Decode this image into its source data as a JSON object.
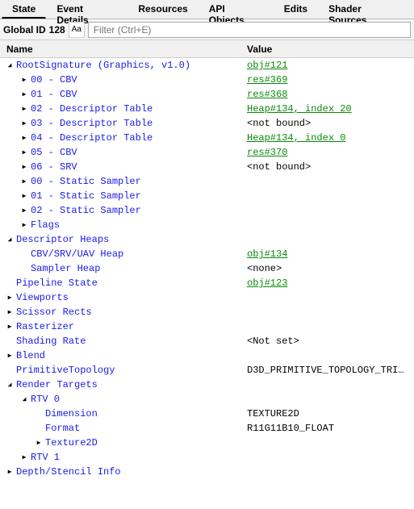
{
  "tabs": [
    {
      "label": "State",
      "active": true
    },
    {
      "label": "Event Details",
      "active": false
    },
    {
      "label": "Resources",
      "active": false
    },
    {
      "label": "API Objects",
      "active": false
    },
    {
      "label": "Edits",
      "active": false
    },
    {
      "label": "Shader Sources",
      "active": false
    }
  ],
  "toolbar": {
    "global_id_label": "Global ID",
    "global_id_value": "128",
    "aa_label": "Aa",
    "filter_placeholder": "Filter (Ctrl+E)"
  },
  "columns": {
    "name": "Name",
    "value": "Value"
  },
  "rows": [
    {
      "depth": 0,
      "twisty": "open",
      "name": "RootSignature (Graphics, v1.0)",
      "value": "obj#121",
      "vstyle": "link"
    },
    {
      "depth": 1,
      "twisty": "closed",
      "name": "00 - CBV",
      "value": "res#369",
      "vstyle": "link"
    },
    {
      "depth": 1,
      "twisty": "closed",
      "name": "01 - CBV",
      "value": "res#368",
      "vstyle": "link"
    },
    {
      "depth": 1,
      "twisty": "closed",
      "name": "02 - Descriptor Table",
      "value": "Heap#134, index 20",
      "vstyle": "link"
    },
    {
      "depth": 1,
      "twisty": "closed",
      "name": "03 - Descriptor Table",
      "value": "<not bound>",
      "vstyle": "plain"
    },
    {
      "depth": 1,
      "twisty": "closed",
      "name": "04 - Descriptor Table",
      "value": "Heap#134, index 0",
      "vstyle": "link"
    },
    {
      "depth": 1,
      "twisty": "closed",
      "name": "05 - CBV",
      "value": "res#370",
      "vstyle": "link"
    },
    {
      "depth": 1,
      "twisty": "closed",
      "name": "06 - SRV",
      "value": "<not bound>",
      "vstyle": "plain"
    },
    {
      "depth": 1,
      "twisty": "closed",
      "name": "00 - Static Sampler",
      "value": "",
      "vstyle": "plain"
    },
    {
      "depth": 1,
      "twisty": "closed",
      "name": "01 - Static Sampler",
      "value": "",
      "vstyle": "plain"
    },
    {
      "depth": 1,
      "twisty": "closed",
      "name": "02 - Static Sampler",
      "value": "",
      "vstyle": "plain"
    },
    {
      "depth": 1,
      "twisty": "closed",
      "name": "Flags",
      "value": "",
      "vstyle": "plain"
    },
    {
      "depth": 0,
      "twisty": "open",
      "name": "Descriptor Heaps",
      "value": "",
      "vstyle": "plain"
    },
    {
      "depth": 1,
      "twisty": "none",
      "name": "CBV/SRV/UAV Heap",
      "value": "obj#134",
      "vstyle": "link"
    },
    {
      "depth": 1,
      "twisty": "none",
      "name": "Sampler Heap",
      "value": "<none>",
      "vstyle": "plain"
    },
    {
      "depth": 0,
      "twisty": "none",
      "name": "Pipeline State",
      "value": "obj#123",
      "vstyle": "link"
    },
    {
      "depth": 0,
      "twisty": "closed",
      "name": "Viewports",
      "value": "",
      "vstyle": "plain"
    },
    {
      "depth": 0,
      "twisty": "closed",
      "name": "Scissor Rects",
      "value": "",
      "vstyle": "plain"
    },
    {
      "depth": 0,
      "twisty": "closed",
      "name": "Rasterizer",
      "value": "",
      "vstyle": "plain"
    },
    {
      "depth": 0,
      "twisty": "none",
      "name": "Shading Rate",
      "value": "<Not set>",
      "vstyle": "plain"
    },
    {
      "depth": 0,
      "twisty": "closed",
      "name": "Blend",
      "value": "",
      "vstyle": "plain"
    },
    {
      "depth": 0,
      "twisty": "none",
      "name": "PrimitiveTopology",
      "value": "D3D_PRIMITIVE_TOPOLOGY_TRI…",
      "vstyle": "plain"
    },
    {
      "depth": 0,
      "twisty": "open",
      "name": "Render Targets",
      "value": "",
      "vstyle": "plain"
    },
    {
      "depth": 1,
      "twisty": "open",
      "name": "RTV 0",
      "value": "",
      "vstyle": "plain"
    },
    {
      "depth": 2,
      "twisty": "none",
      "name": "Dimension",
      "value": "TEXTURE2D",
      "vstyle": "plain"
    },
    {
      "depth": 2,
      "twisty": "none",
      "name": "Format",
      "value": "R11G11B10_FLOAT",
      "vstyle": "plain"
    },
    {
      "depth": 2,
      "twisty": "closed",
      "name": "Texture2D",
      "value": "",
      "vstyle": "plain"
    },
    {
      "depth": 1,
      "twisty": "closed",
      "name": "RTV 1",
      "value": "",
      "vstyle": "plain"
    },
    {
      "depth": 0,
      "twisty": "closed",
      "name": "Depth/Stencil Info",
      "value": "",
      "vstyle": "plain"
    }
  ]
}
